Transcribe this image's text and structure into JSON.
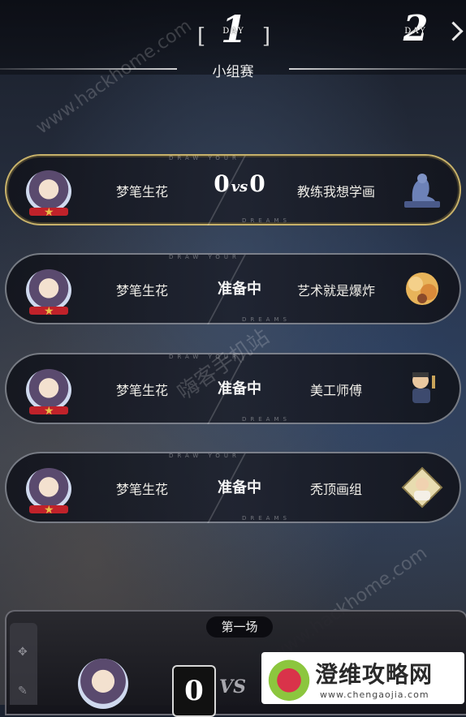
{
  "header": {
    "day_current": "1",
    "day_next": "2",
    "day_label": "DAY",
    "stage_title": "小组赛"
  },
  "matches": [
    {
      "team_left": "梦笔生花",
      "team_right": "教练我想学画",
      "score_left": "0",
      "score_right": "0",
      "vs": "vs",
      "status": "",
      "opponent_icon": "silhouette-icon",
      "active": true
    },
    {
      "team_left": "梦笔生花",
      "team_right": "艺术就是爆炸",
      "status": "准备中",
      "opponent_icon": "explosion-icon",
      "active": false
    },
    {
      "team_left": "梦笔生花",
      "team_right": "美工师傅",
      "status": "准备中",
      "opponent_icon": "craftsman-icon",
      "active": false
    },
    {
      "team_left": "梦笔生花",
      "team_right": "秃顶画组",
      "status": "准备中",
      "opponent_icon": "bald-painter-icon",
      "active": false
    }
  ],
  "card_deco": {
    "top": "DRAW YOUR",
    "bottom": "DREAMS"
  },
  "panel": {
    "round_label": "第一场",
    "score": "0",
    "vs": "VS"
  },
  "watermarks": {
    "site_top": "www.hackhome.com",
    "site_mid": "嗨客手机站",
    "site_bottom": "www.hackhome.com",
    "brand_name": "澄维攻略网",
    "brand_url": "www.chengaojia.com"
  },
  "colors": {
    "active_border": "#c8b26a",
    "card_border": "#c8cdd7"
  }
}
